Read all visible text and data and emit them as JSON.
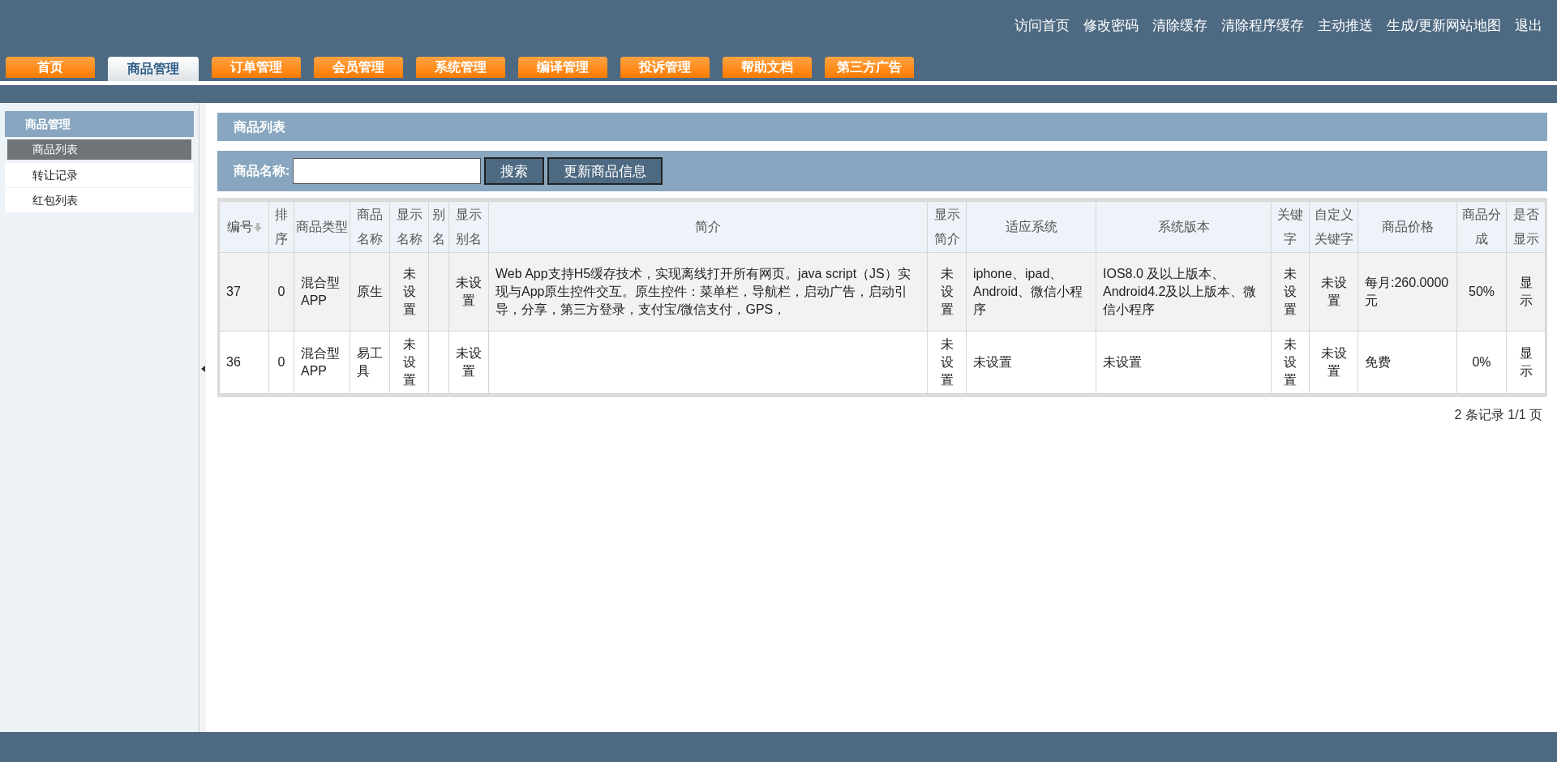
{
  "top_links": [
    "访问首页",
    "修改密码",
    "清除缓存",
    "清除程序缓存",
    "主动推送",
    "生成/更新网站地图",
    "退出"
  ],
  "tabs": [
    {
      "label": "首页",
      "selected": false
    },
    {
      "label": "商品管理",
      "selected": true
    },
    {
      "label": "订单管理",
      "selected": false
    },
    {
      "label": "会员管理",
      "selected": false
    },
    {
      "label": "系统管理",
      "selected": false
    },
    {
      "label": "编译管理",
      "selected": false
    },
    {
      "label": "投诉管理",
      "selected": false
    },
    {
      "label": "帮助文档",
      "selected": false
    },
    {
      "label": "第三方广告",
      "selected": false
    }
  ],
  "sidebar": {
    "title": "商品管理",
    "items": [
      {
        "label": "商品列表",
        "selected": true
      },
      {
        "label": "转让记录",
        "selected": false
      },
      {
        "label": "红包列表",
        "selected": false
      }
    ]
  },
  "panel_title": "商品列表",
  "search": {
    "label": "商品名称:",
    "buttons": [
      "搜索",
      "更新商品信息"
    ]
  },
  "table": {
    "columns": [
      {
        "label": "编号",
        "sortable": true
      },
      {
        "label": "排序",
        "sortable": false
      },
      {
        "label": "商品类型",
        "sortable": false
      },
      {
        "label": "商品名称",
        "sortable": false
      },
      {
        "label": "显示名称",
        "sortable": false
      },
      {
        "label": "别名",
        "sortable": false
      },
      {
        "label": "显示别名",
        "sortable": false
      },
      {
        "label": "简介",
        "sortable": false
      },
      {
        "label": "显示简介",
        "sortable": false
      },
      {
        "label": "适应系统",
        "sortable": false
      },
      {
        "label": "系统版本",
        "sortable": false
      },
      {
        "label": "关键字",
        "sortable": false
      },
      {
        "label": "自定义关键字",
        "sortable": false
      },
      {
        "label": "商品价格",
        "sortable": false
      },
      {
        "label": "商品分成",
        "sortable": false
      },
      {
        "label": "是否显示",
        "sortable": false
      }
    ],
    "rows": [
      [
        "37",
        "0",
        "混合型APP",
        "原生",
        "未设置",
        "",
        "未设置",
        "Web App支持H5缓存技术，实现离线打开所有网页。java script（JS）实现与App原生控件交互。原生控件：菜单栏，导航栏，启动广告，启动引导，分享，第三方登录，支付宝/微信支付，GPS，",
        "未设置",
        "iphone、ipad、Android、微信小程序",
        "IOS8.0 及以上版本、Android4.2及以上版本、微信小程序",
        "未设置",
        "未设置",
        "每月:260.0000元",
        "50%",
        "显示"
      ],
      [
        "36",
        "0",
        "混合型APP",
        "易工具",
        "未设置",
        "",
        "未设置",
        "",
        "未设置",
        "未设置",
        "未设置",
        "未设置",
        "未设置",
        "免费",
        "0%",
        "显示"
      ]
    ]
  },
  "pagination": "2 条记录 1/1 页"
}
